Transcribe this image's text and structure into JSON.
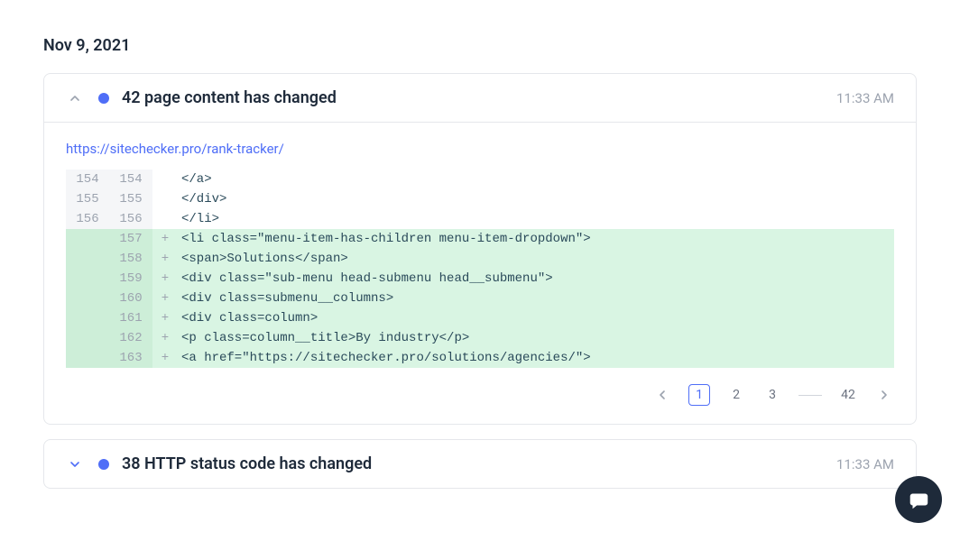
{
  "date": "Nov 9, 2021",
  "events": [
    {
      "title": "42 page content has changed",
      "time": "11:33 AM",
      "url": "https://sitechecker.pro/rank-tracker/"
    },
    {
      "title": "38 HTTP status code has changed",
      "time": "11:33 AM"
    }
  ],
  "diff": [
    {
      "old": "154",
      "new": "154",
      "sign": "",
      "code": "</a>",
      "added": false
    },
    {
      "old": "155",
      "new": "155",
      "sign": "",
      "code": "</div>",
      "added": false
    },
    {
      "old": "156",
      "new": "156",
      "sign": "",
      "code": "</li>",
      "added": false
    },
    {
      "old": "",
      "new": "157",
      "sign": "+",
      "code": "<li class=\"menu-item-has-children menu-item-dropdown\">",
      "added": true
    },
    {
      "old": "",
      "new": "158",
      "sign": "+",
      "code": "<span>Solutions</span>",
      "added": true
    },
    {
      "old": "",
      "new": "159",
      "sign": "+",
      "code": "<div class=\"sub-menu head-submenu head__submenu\">",
      "added": true
    },
    {
      "old": "",
      "new": "160",
      "sign": "+",
      "code": "<div class=submenu__columns>",
      "added": true
    },
    {
      "old": "",
      "new": "161",
      "sign": "+",
      "code": "<div class=column>",
      "added": true
    },
    {
      "old": "",
      "new": "162",
      "sign": "+",
      "code": "<p class=column__title>By industry</p>",
      "added": true
    },
    {
      "old": "",
      "new": "163",
      "sign": "+",
      "code": "<a href=\"https://sitechecker.pro/solutions/agencies/\">",
      "added": true
    }
  ],
  "pagination": {
    "pages": [
      "1",
      "2",
      "3"
    ],
    "last": "42",
    "active": 0
  }
}
